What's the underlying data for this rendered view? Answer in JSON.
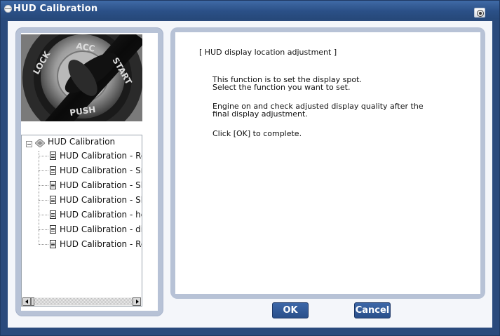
{
  "window": {
    "title": "HUD Calibration"
  },
  "sidebar": {
    "photo_alt_icon": "ignition-key-switch-icon",
    "tree": {
      "root_label": "HUD Calibration",
      "items": [
        {
          "label": "HUD Calibration - Re"
        },
        {
          "label": "HUD Calibration - Sr"
        },
        {
          "label": "HUD Calibration - Sl"
        },
        {
          "label": "HUD Calibration - Sl"
        },
        {
          "label": "HUD Calibration - hc"
        },
        {
          "label": "HUD Calibration - di:"
        },
        {
          "label": "HUD Calibration - Re"
        }
      ]
    }
  },
  "main": {
    "heading": "[ HUD display location adjustment ]",
    "paragraph1_line1": "This function is to set the display spot.",
    "paragraph1_line2": "Select the function you want to set.",
    "paragraph2_line1": "Engine on and check adjusted display quality after the",
    "paragraph2_line2": "final display adjustment.",
    "paragraph3": "Click [OK] to complete."
  },
  "buttons": {
    "ok_label": "OK",
    "cancel_label": "Cancel"
  },
  "colors": {
    "titlebar": "#2b5087",
    "panel": "#b7c2d6",
    "button": "#2a4f8a"
  }
}
